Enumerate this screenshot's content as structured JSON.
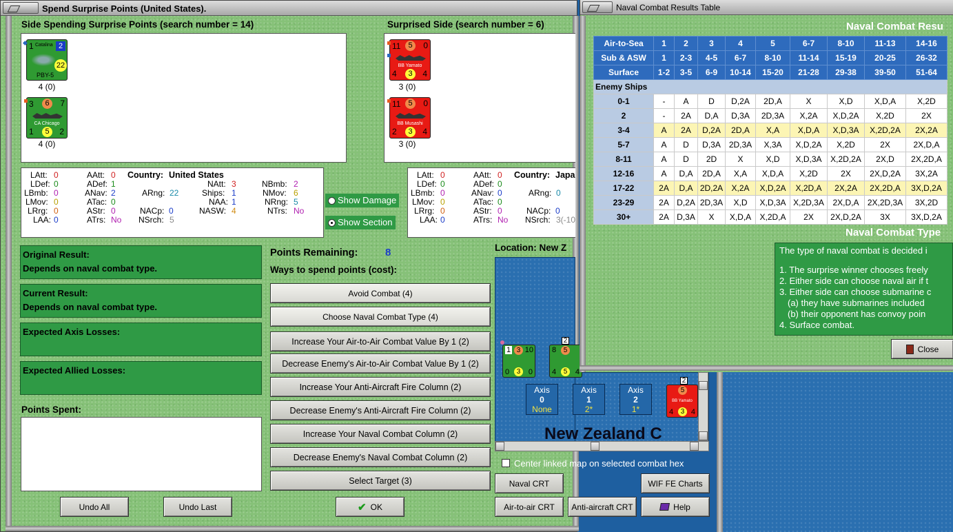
{
  "left_window": {
    "title": "Spend Surprise Points (United States).",
    "spending_side_header": "Side Spending Surprise Points (search number = 14)",
    "surprised_side_header": "Surprised Side (search number = 6)",
    "spending_units": [
      {
        "name": "Catalina",
        "bottom_name": "PBY-5",
        "tr": "2",
        "big": "22",
        "caption": "4 (0)"
      },
      {
        "name": "CA Chicago",
        "tl": "3",
        "mid": "6",
        "tr": "7",
        "bl": "1",
        "bm": "5",
        "br": "2",
        "caption": "4 (0)"
      }
    ],
    "surprised_units": [
      {
        "name": "BB Yamato",
        "tl": "11",
        "mid": "5",
        "tr": "0",
        "bl": "4",
        "bm": "3",
        "br": "4",
        "caption": "3 (0)"
      },
      {
        "name": "BB Musashi",
        "tl": "11",
        "mid": "5",
        "tr": "0",
        "bl": "2",
        "bm": "3",
        "br": "4",
        "caption": "3 (0)"
      }
    ],
    "allied_stats": {
      "country_label": "Country:",
      "country": "United States",
      "latt_l": "LAtt:",
      "latt": "0",
      "ldef_l": "LDef:",
      "ldef": "0",
      "lbmb_l": "LBmb:",
      "lbmb": "0",
      "lmov_l": "LMov:",
      "lmov": "0",
      "lrrg_l": "LRrg:",
      "lrrg": "0",
      "laa_l": "LAA:",
      "laa": "0",
      "aatt_l": "AAtt:",
      "aatt": "0",
      "adef_l": "ADef:",
      "adef": "1",
      "anav_l": "ANav:",
      "anav": "2",
      "atac_l": "ATac:",
      "atac": "0",
      "astr_l": "AStr:",
      "astr": "0",
      "atrs_l": "ATrs:",
      "atrs": "No",
      "arng_l": "ARng:",
      "arng": "22",
      "nacp_l": "NACp:",
      "nacp": "0",
      "nsrch_l": "NSrch:",
      "nsrch": "5",
      "natt_l": "NAtt:",
      "natt": "3",
      "ships_l": "Ships:",
      "ships": "1",
      "naa_l": "NAA:",
      "naa": "1",
      "nasw_l": "NASW:",
      "nasw": "4",
      "nbmb_l": "NBmb:",
      "nbmb": "2",
      "nmov_l": "NMov:",
      "nmov": "6",
      "nrng_l": "NRng:",
      "nrng": "5",
      "ntrs_l": "NTrs:",
      "ntrs": "No"
    },
    "axis_stats": {
      "country_label": "Country:",
      "country": "Japa",
      "latt_l": "LAtt:",
      "latt": "0",
      "ldef_l": "LDef:",
      "ldef": "0",
      "lbmb_l": "LBmb:",
      "lbmb": "0",
      "lmov_l": "LMov:",
      "lmov": "0",
      "lrrg_l": "LRrg:",
      "lrrg": "0",
      "laa_l": "LAA:",
      "laa": "0",
      "aatt_l": "AAtt:",
      "aatt": "0",
      "adef_l": "ADef:",
      "adef": "0",
      "anav_l": "ANav:",
      "anav": "0",
      "atac_l": "ATac:",
      "atac": "0",
      "astr_l": "AStr:",
      "astr": "0",
      "atrs_l": "ATrs:",
      "atrs": "No",
      "arng_l": "ARng:",
      "arng": "0",
      "nacp_l": "NACp:",
      "nacp": "0",
      "nsrch_l": "NSrch:",
      "nsrch": "3(-10"
    },
    "show_damage": "Show Damage",
    "show_section": "Show Section",
    "original_result_label": "Original Result:",
    "original_result": "Depends on naval combat type.",
    "current_result_label": "Current Result:",
    "current_result": "Depends on naval combat type.",
    "expected_axis_label": "Expected Axis Losses:",
    "expected_allied_label": "Expected Allied Losses:",
    "points_spent_label": "Points Spent:",
    "points_remaining_label": "Points Remaining:",
    "points_remaining": "8",
    "ways_label": "Ways to spend points (cost):",
    "options": [
      "Avoid Combat (4)",
      "Choose Naval Combat Type (4)",
      "Increase Your Air-to-Air Combat Value By 1 (2)",
      "Decrease Enemy's Air-to-Air Combat Value By 1 (2)",
      "Increase Your Anti-Aircraft Fire Column (2)",
      "Decrease Enemy's Anti-Aircraft Fire Column (2)",
      "Increase Your Naval Combat Column (2)",
      "Decrease Enemy's Naval Combat Column (2)",
      "Select Target (3)"
    ],
    "undo_all": "Undo All",
    "undo_last": "Undo Last",
    "ok": "OK",
    "location_label": "Location: New Z",
    "map_label": "New Zealand C",
    "axis_boxes": [
      {
        "label": "Axis",
        "num": "0",
        "sub": "None"
      },
      {
        "label": "Axis",
        "num": "1",
        "sub": "2*"
      },
      {
        "label": "Axis",
        "num": "2",
        "sub": "1*"
      }
    ],
    "map_units": [
      {
        "tl": "1",
        "mid": "3",
        "tr": "10",
        "bl": "0",
        "bm": "3",
        "br": "0"
      },
      {
        "tl": "8",
        "mid": "5",
        "tr": "",
        "bl": "4",
        "bm": "5",
        "br": "4",
        "stack": "2"
      },
      {
        "tl": "",
        "mid": "5",
        "tr": "",
        "bl": "4",
        "bm": "3",
        "br": "4",
        "name": "BB Yamato",
        "stack": "2"
      }
    ],
    "center_map": "Center linked map on selected combat hex",
    "naval_crt": "Naval CRT",
    "wif_charts": "WIF FE Charts",
    "air_crt": "Air-to-air CRT",
    "aa_crt": "Anti-aircraft CRT",
    "help": "Help"
  },
  "right_window": {
    "title": "Naval Combat Results Table",
    "section_title": "Naval Combat Resu",
    "type_title": "Naval Combat Type",
    "header_rows": [
      {
        "label": "Air-to-Sea",
        "cells": [
          "1",
          "2",
          "3",
          "4",
          "5",
          "6-7",
          "8-10",
          "11-13",
          "14-16"
        ]
      },
      {
        "label": "Sub & ASW",
        "cells": [
          "1",
          "2-3",
          "4-5",
          "6-7",
          "8-10",
          "11-14",
          "15-19",
          "20-25",
          "26-32"
        ]
      },
      {
        "label": "Surface",
        "cells": [
          "1-2",
          "3-5",
          "6-9",
          "10-14",
          "15-20",
          "21-28",
          "29-38",
          "39-50",
          "51-64"
        ]
      }
    ],
    "enemy_ships_label": "Enemy Ships",
    "rows": [
      {
        "label": "0-1",
        "cells": [
          "-",
          "A",
          "D",
          "D,2A",
          "2D,A",
          "X",
          "X,D",
          "X,D,A",
          "X,2D"
        ]
      },
      {
        "label": "2",
        "cells": [
          "-",
          "2A",
          "D,A",
          "D,3A",
          "2D,3A",
          "X,2A",
          "X,D,2A",
          "X,2D",
          "2X"
        ]
      },
      {
        "label": "3-4",
        "cells": [
          "A",
          "2A",
          "D,2A",
          "2D,A",
          "X,A",
          "X,D,A",
          "X,D,3A",
          "X,2D,2A",
          "2X,2A"
        ]
      },
      {
        "label": "5-7",
        "cells": [
          "A",
          "D",
          "D,3A",
          "2D,3A",
          "X,3A",
          "X,D,2A",
          "X,2D",
          "2X",
          "2X,D,A"
        ]
      },
      {
        "label": "8-11",
        "cells": [
          "A",
          "D",
          "2D",
          "X",
          "X,D",
          "X,D,3A",
          "X,2D,2A",
          "2X,D",
          "2X,2D,A"
        ]
      },
      {
        "label": "12-16",
        "cells": [
          "A",
          "D,A",
          "2D,A",
          "X,A",
          "X,D,A",
          "X,2D",
          "2X",
          "2X,D,2A",
          "3X,2A"
        ]
      },
      {
        "label": "17-22",
        "cells": [
          "2A",
          "D,A",
          "2D,2A",
          "X,2A",
          "X,D,2A",
          "X,2D,A",
          "2X,2A",
          "2X,2D,A",
          "3X,D,2A"
        ]
      },
      {
        "label": "23-29",
        "cells": [
          "2A",
          "D,2A",
          "2D,3A",
          "X,D",
          "X,D,3A",
          "X,2D,3A",
          "2X,D,A",
          "2X,2D,3A",
          "3X,2D"
        ]
      },
      {
        "label": "30+",
        "cells": [
          "2A",
          "D,3A",
          "X",
          "X,D,A",
          "X,2D,A",
          "2X",
          "2X,D,2A",
          "3X",
          "3X,D,2A"
        ]
      }
    ],
    "type_text": [
      "The type of naval combat is decided i",
      "",
      "1. The surprise winner chooses freely",
      "2. Either side can choose naval air if t",
      "3. Either side can choose submarine c",
      "   (a) they have submarines included",
      "   (b) their opponent has convoy poin",
      "4. Surface combat."
    ],
    "close": "Close"
  },
  "colors": {
    "felt": "#86c178",
    "panel_green": "#2f9a45",
    "header_blue": "#2e6bbd",
    "highlight_yellow": "#fcf5b4",
    "allied_green": "#2f9a32",
    "axis_red": "#e81a14",
    "ocean": "#2a6fb0"
  }
}
